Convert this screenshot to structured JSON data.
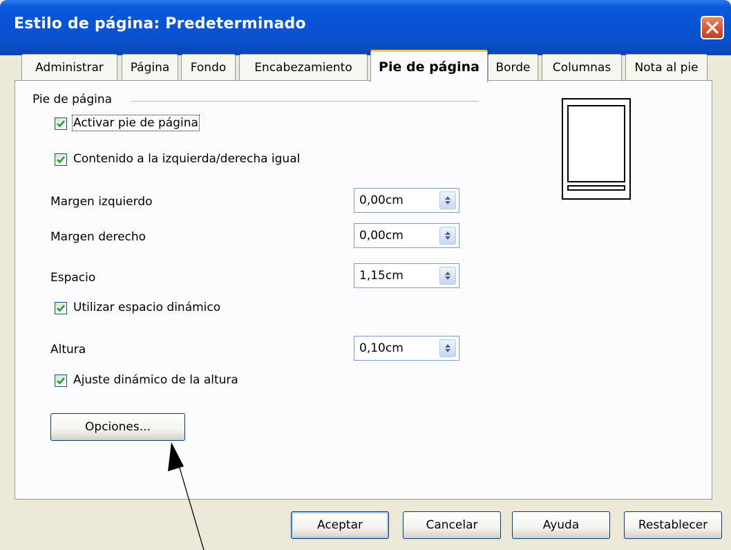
{
  "window": {
    "title": "Estilo de página: Predeterminado"
  },
  "tabs": [
    {
      "label": "Administrar"
    },
    {
      "label": "Página"
    },
    {
      "label": "Fondo"
    },
    {
      "label": "Encabezamiento"
    },
    {
      "label": "Pie de página"
    },
    {
      "label": "Borde"
    },
    {
      "label": "Columnas"
    },
    {
      "label": "Nota al pie"
    }
  ],
  "section": {
    "title": "Pie de página"
  },
  "checkboxes": {
    "activar": {
      "label": "Activar pie de página",
      "checked": true
    },
    "contenido": {
      "label": "Contenido a la izquierda/derecha igual",
      "checked": true
    },
    "espacio_dinamico": {
      "label": "Utilizar espacio dinámico",
      "checked": true
    },
    "ajuste_altura": {
      "label": "Ajuste dinámico de la altura",
      "checked": true
    }
  },
  "fields": {
    "margen_izq": {
      "label": "Margen izquierdo",
      "value": "0,00cm"
    },
    "margen_der": {
      "label": "Margen derecho",
      "value": "0,00cm"
    },
    "espacio": {
      "label": "Espacio",
      "value": "1,15cm"
    },
    "altura": {
      "label": "Altura",
      "value": "0,10cm"
    }
  },
  "buttons": {
    "opciones": "Opciones...",
    "aceptar": "Aceptar",
    "cancelar": "Cancelar",
    "ayuda": "Ayuda",
    "restablecer": "Restablecer"
  },
  "colors": {
    "titlebar": "#0854d8",
    "close": "#d6532f",
    "active_tab_accent": "#ffc83c",
    "dialog_bg": "#ece9d8",
    "checkmark": "#21a121"
  },
  "icons": {
    "close": "close-icon",
    "checkbox": "checkmark-icon",
    "spin": "spin-arrows-icon",
    "annotation": "arrow-icon"
  }
}
